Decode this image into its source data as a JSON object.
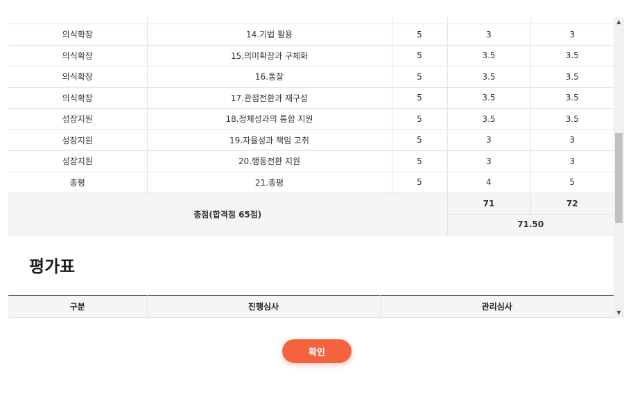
{
  "score_table": {
    "rows": [
      {
        "category": "의식확장",
        "item": "14.기법 활용",
        "max": "5",
        "score1": "3",
        "score2": "3"
      },
      {
        "category": "의식확장",
        "item": "15.의미확장과 구체화",
        "max": "5",
        "score1": "3.5",
        "score2": "3.5"
      },
      {
        "category": "의식확장",
        "item": "16.통찰",
        "max": "5",
        "score1": "3.5",
        "score2": "3.5"
      },
      {
        "category": "의식확장",
        "item": "17.관점전환과 재구성",
        "max": "5",
        "score1": "3.5",
        "score2": "3.5"
      },
      {
        "category": "성장지원",
        "item": "18.정체성과의 통합 지원",
        "max": "5",
        "score1": "3.5",
        "score2": "3.5"
      },
      {
        "category": "성장지원",
        "item": "19.자율성과 책임 고취",
        "max": "5",
        "score1": "3",
        "score2": "3"
      },
      {
        "category": "성장지원",
        "item": "20.행동전환 지원",
        "max": "5",
        "score1": "3",
        "score2": "3"
      },
      {
        "category": "총평",
        "item": "21.총평",
        "max": "5",
        "score1": "4",
        "score2": "5"
      }
    ],
    "total_label": "총점(합격점 65점)",
    "total1": "71",
    "total2": "72",
    "average": "71.50"
  },
  "eval_section": {
    "title": "평가표",
    "headers": [
      "구분",
      "진행심사",
      "관리심사"
    ]
  },
  "confirm_label": "확인"
}
